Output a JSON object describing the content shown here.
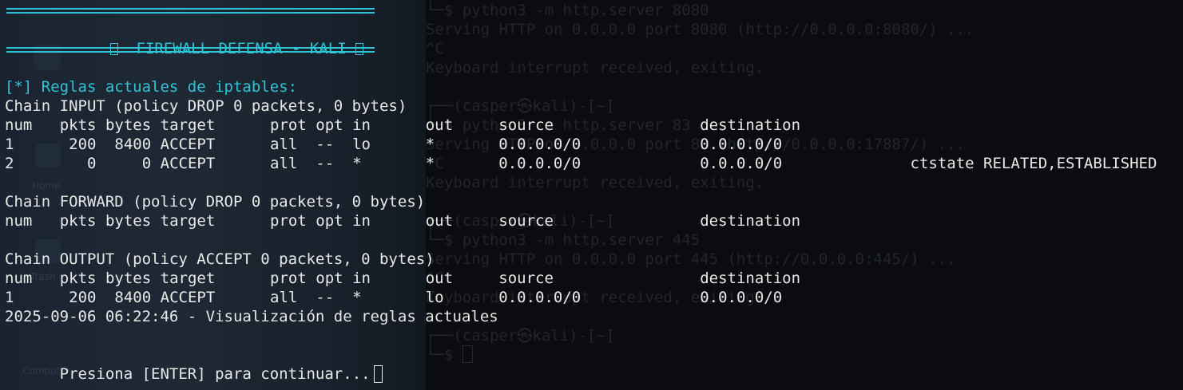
{
  "banner": {
    "title": "FIREWALL DEFENSA - KALI",
    "left_icon": "unknown-glyph-icon",
    "right_icon": "unknown-glyph-icon"
  },
  "heading": "[*] Reglas actuales de iptables:",
  "chains": [
    {
      "header": "Chain INPUT (policy DROP 0 packets, 0 bytes)",
      "columns": [
        "num",
        "pkts",
        "bytes",
        "target",
        "prot",
        "opt",
        "in",
        "out",
        "source",
        "destination"
      ],
      "rows": [
        {
          "num": "1",
          "pkts": "200",
          "bytes": "8400",
          "target": "ACCEPT",
          "prot": "all",
          "opt": "--",
          "in": "lo",
          "out": "*",
          "source": "0.0.0.0/0",
          "destination": "0.0.0.0/0",
          "extra": ""
        },
        {
          "num": "2",
          "pkts": "0",
          "bytes": "0",
          "target": "ACCEPT",
          "prot": "all",
          "opt": "--",
          "in": "*",
          "out": "*",
          "source": "0.0.0.0/0",
          "destination": "0.0.0.0/0",
          "extra": "ctstate RELATED,ESTABLISHED"
        }
      ]
    },
    {
      "header": "Chain FORWARD (policy DROP 0 packets, 0 bytes)",
      "columns": [
        "num",
        "pkts",
        "bytes",
        "target",
        "prot",
        "opt",
        "in",
        "out",
        "source",
        "destination"
      ],
      "rows": []
    },
    {
      "header": "Chain OUTPUT (policy ACCEPT 0 packets, 0 bytes)",
      "columns": [
        "num",
        "pkts",
        "bytes",
        "target",
        "prot",
        "opt",
        "in",
        "out",
        "source",
        "destination"
      ],
      "rows": [
        {
          "num": "1",
          "pkts": "200",
          "bytes": "8400",
          "target": "ACCEPT",
          "prot": "all",
          "opt": "--",
          "in": "*",
          "out": "lo",
          "source": "0.0.0.0/0",
          "destination": "0.0.0.0/0",
          "extra": ""
        }
      ]
    }
  ],
  "log_line": "2025-09-06 06:22:46 - Visualización de reglas actuales",
  "prompt": "Presiona [ENTER] para continuar...",
  "background_terminal": {
    "lines": [
      "└─$ python3 -m http.server 8080",
      "Serving HTTP on 0.0.0.0 port 8080 (http://0.0.0.0:8080/) ...",
      "^C",
      "Keyboard interrupt received, exiting.",
      "",
      "┌──(casper㉿kali)-[~]",
      "└─$ python3 -m http.server 83",
      "Serving HTTP on 0.0.0.0 port 83 (http://0.0.0.0:17887/) ...",
      "^C",
      "Keyboard interrupt received, exiting.",
      "",
      "┌──(casper㉿kali)-[~]",
      "└─$ python3 -m http.server 445",
      "Serving HTTP on 0.0.0.0 port 445 (http://0.0.0.0:445/) ...",
      "^C",
      "Keyboard interrupt received, exiting.",
      "",
      "┌──(casper㉿kali)-[~]",
      "└─$ "
    ]
  },
  "desktop": {
    "labels": [
      "Home",
      "Trash",
      "Computer"
    ]
  },
  "colors": {
    "accent": "#2ec4d6",
    "text": "#e8e8e8",
    "background": "#0a0c0f"
  }
}
